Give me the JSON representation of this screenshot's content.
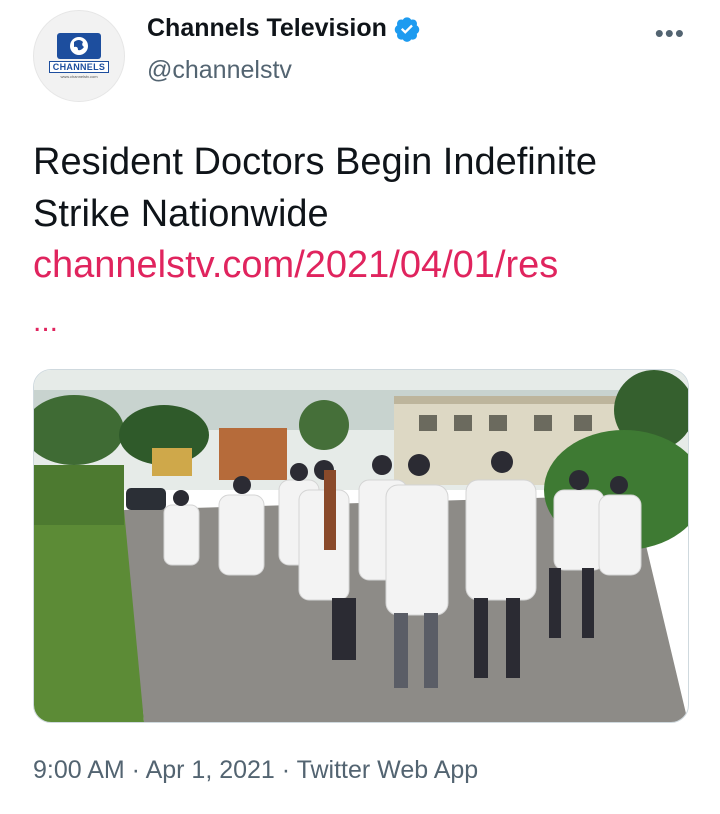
{
  "account": {
    "display_name": "Channels Television",
    "handle": "@channelstv",
    "avatar_brand": "CHANNELS",
    "avatar_url": "www.channelstv.com",
    "verified": true
  },
  "tweet": {
    "text": "Resident Doctors Begin Indefinite Strike Nationwide",
    "link": "channelstv.com/2021/04/01/res",
    "link_ellipsis": "...",
    "more_label": "•••"
  },
  "meta": {
    "time": "9:00 AM",
    "separator": " · ",
    "date": "Apr 1, 2021",
    "source": "Twitter Web App"
  },
  "colors": {
    "link": "#e0245e",
    "verified": "#1d9bf0",
    "muted": "#536471"
  }
}
